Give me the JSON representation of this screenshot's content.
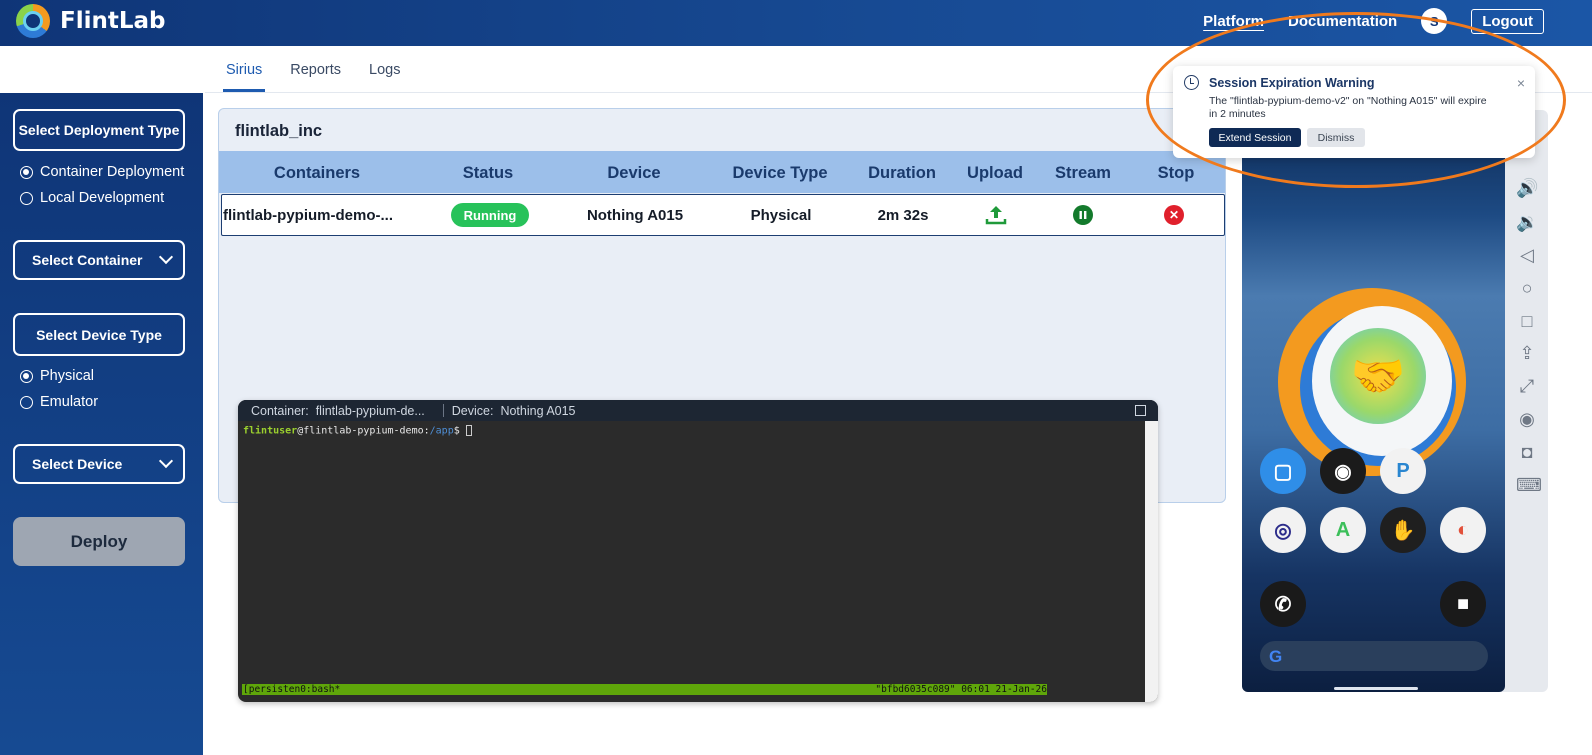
{
  "brand": {
    "name": "FlintLab"
  },
  "nav": {
    "platform": "Platform",
    "documentation": "Documentation",
    "avatar_initial": "S",
    "logout": "Logout"
  },
  "tabs": [
    {
      "label": "Sirius"
    },
    {
      "label": "Reports"
    },
    {
      "label": "Logs"
    }
  ],
  "sidebar": {
    "deployment_type_button": "Select Deployment Type",
    "deployment_options": [
      {
        "label": "Container Deployment",
        "selected": true
      },
      {
        "label": "Local Development",
        "selected": false
      }
    ],
    "container_select": "Select Container",
    "device_type_button": "Select Device Type",
    "device_type_options": [
      {
        "label": "Physical",
        "selected": true
      },
      {
        "label": "Emulator",
        "selected": false
      }
    ],
    "device_select": "Select Device",
    "deploy_button": "Deploy"
  },
  "main": {
    "org": "flintlab_inc",
    "columns": [
      "Containers",
      "Status",
      "Device",
      "Device Type",
      "Duration",
      "Upload",
      "Stream",
      "Stop"
    ],
    "rows": [
      {
        "container": "flintlab-pypium-demo-...",
        "status": "Running",
        "device": "Nothing A015",
        "device_type": "Physical",
        "duration": "2m 32s"
      }
    ]
  },
  "terminal": {
    "container_label": "Container:",
    "container_value": "flintlab-pypium-de...",
    "device_label": "Device:",
    "device_value": "Nothing A015",
    "prompt_user": "flintuser",
    "prompt_host": "@flintlab-pypium-demo:",
    "prompt_path": "/app",
    "prompt_symbol": "$",
    "status_left": "[persisten0:bash*",
    "status_right": "\"bfbd6035c089\" 06:01 21-Jan-26"
  },
  "notification": {
    "title": "Session Expiration Warning",
    "message": "The \"flintlab-pypium-demo-v2\" on \"Nothing A015\" will expire in 2 minutes",
    "extend": "Extend Session",
    "dismiss": "Dismiss",
    "close": "×"
  },
  "colors": {
    "primary": "#0f3577",
    "accent": "#1e5bb0",
    "running": "#27c25a",
    "stop": "#e0202c",
    "highlight": "#f07a1d"
  }
}
